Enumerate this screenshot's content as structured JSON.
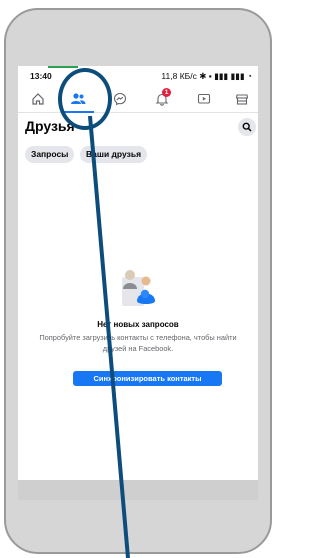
{
  "status_bar": {
    "time": "13:40",
    "net_speed": "11,8 КБ/с"
  },
  "tabs": [
    {
      "name": "home",
      "icon": "home-icon"
    },
    {
      "name": "friends",
      "icon": "friends-icon",
      "active": true
    },
    {
      "name": "messenger",
      "icon": "messenger-icon"
    },
    {
      "name": "notifications",
      "icon": "bell-icon",
      "badge": "1"
    },
    {
      "name": "watch",
      "icon": "video-icon"
    },
    {
      "name": "marketplace",
      "icon": "store-icon"
    }
  ],
  "page": {
    "title": "Друзья",
    "chips": [
      "Запросы",
      "Ваши друзья"
    ]
  },
  "empty_state": {
    "title": "Нет новых запросов",
    "description": "Попробуйте загрузить контакты с телефона, чтобы найти друзей на Facebook.",
    "button": "Синхронизировать контакты"
  },
  "colors": {
    "accent": "#1877f2",
    "badge": "#e41e3f",
    "annotation": "#0d4d7c"
  }
}
